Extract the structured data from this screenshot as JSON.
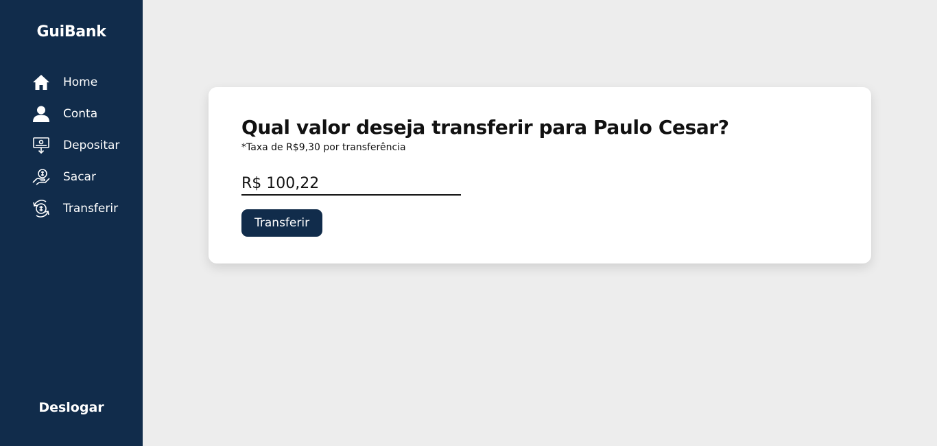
{
  "app": {
    "name": "GuiBank"
  },
  "colors": {
    "sidebar": "#112c4b",
    "background": "#ededed",
    "card": "#ffffff",
    "accent": "#112c4b"
  },
  "sidebar": {
    "items": [
      {
        "label": "Home",
        "icon": "home-icon"
      },
      {
        "label": "Conta",
        "icon": "user-icon"
      },
      {
        "label": "Depositar",
        "icon": "deposit-icon"
      },
      {
        "label": "Sacar",
        "icon": "withdraw-icon"
      },
      {
        "label": "Transferir",
        "icon": "transfer-icon"
      }
    ],
    "logout_label": "Deslogar"
  },
  "transfer": {
    "title": "Qual valor deseja transferir para Paulo Cesar?",
    "fee_note": "*Taxa de R$9,30 por transferência",
    "amount_value": "R$ 100,22",
    "submit_label": "Transferir"
  }
}
